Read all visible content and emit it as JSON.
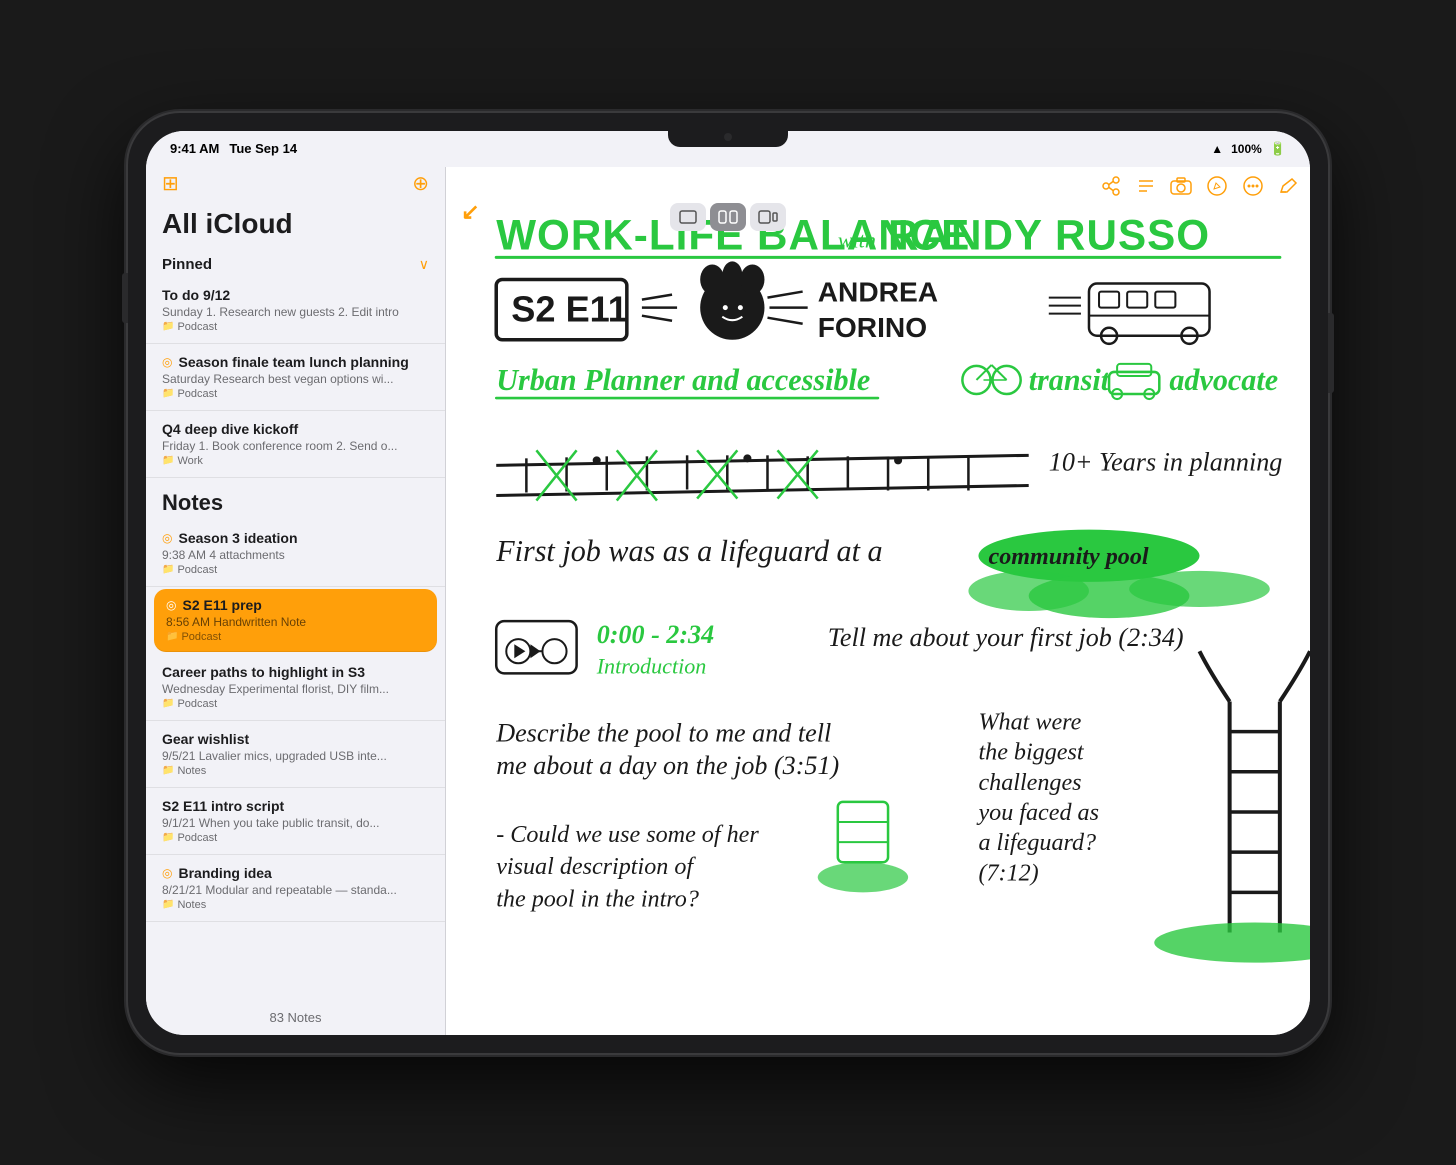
{
  "device": {
    "time": "9:41 AM",
    "date": "Tue Sep 14",
    "battery": "100%",
    "wifi": true
  },
  "toolbar": {
    "layout_options": [
      "single",
      "split",
      "side"
    ],
    "active_layout": "split"
  },
  "sidebar": {
    "title": "All iCloud",
    "sections": {
      "pinned": {
        "label": "Pinned",
        "notes": [
          {
            "title": "To do 9/12",
            "meta": "Sunday  1. Research new guests 2. Edit intro",
            "folder": "Podcast",
            "pinned": false
          },
          {
            "title": "Season finale team lunch planning",
            "meta": "Saturday  Research best vegan options wi...",
            "folder": "Podcast",
            "pinned": true
          },
          {
            "title": "Q4 deep dive kickoff",
            "meta": "Friday  1. Book conference room 2. Send o...",
            "folder": "Work",
            "pinned": false
          }
        ]
      },
      "notes": {
        "label": "Notes",
        "notes": [
          {
            "title": "Season 3 ideation",
            "meta": "9:38 AM  4 attachments",
            "folder": "Podcast",
            "pinned": true,
            "selected": false
          },
          {
            "title": "S2 E11 prep",
            "meta": "8:56 AM  Handwritten Note",
            "folder": "Podcast",
            "pinned": true,
            "selected": true
          },
          {
            "title": "Career paths to highlight in S3",
            "meta": "Wednesday  Experimental florist, DIY film...",
            "folder": "Podcast",
            "pinned": false,
            "selected": false
          },
          {
            "title": "Gear wishlist",
            "meta": "9/5/21  Lavalier mics, upgraded USB inte...",
            "folder": "Notes",
            "pinned": false,
            "selected": false
          },
          {
            "title": "S2 E11 intro script",
            "meta": "9/1/21  When you take public transit, do...",
            "folder": "Podcast",
            "pinned": false,
            "selected": false
          },
          {
            "title": "Branding idea",
            "meta": "8/21/21  Modular and repeatable — standa...",
            "folder": "Notes",
            "pinned": true,
            "selected": false
          }
        ]
      }
    },
    "count": "83 Notes"
  },
  "note_toolbar": {
    "icons": [
      "people",
      "list",
      "camera",
      "pen",
      "more",
      "compose"
    ]
  },
  "note_content": {
    "title": "WORK-LIFE BALANCE with RANDY RUSSO",
    "episode": "S2 E11",
    "guest": "ANDREA FORINO",
    "role": "Urban Planner and accessible transit advocate",
    "experience": "10+ Years in planning",
    "first_job": "First job was as a lifeguard at a community pool",
    "segments": [
      {
        "time": "0:00 - 2:34",
        "label": "Introduction",
        "question": "Tell me about your first job (2:34)"
      }
    ],
    "questions": [
      "Describe the pool to me and tell me about a day on the job (3:51)",
      "What were the biggest challenges you faced as a lifeguard? (7:12)"
    ],
    "note": "- Could we use some of her visual description of the pool in the intro?"
  }
}
